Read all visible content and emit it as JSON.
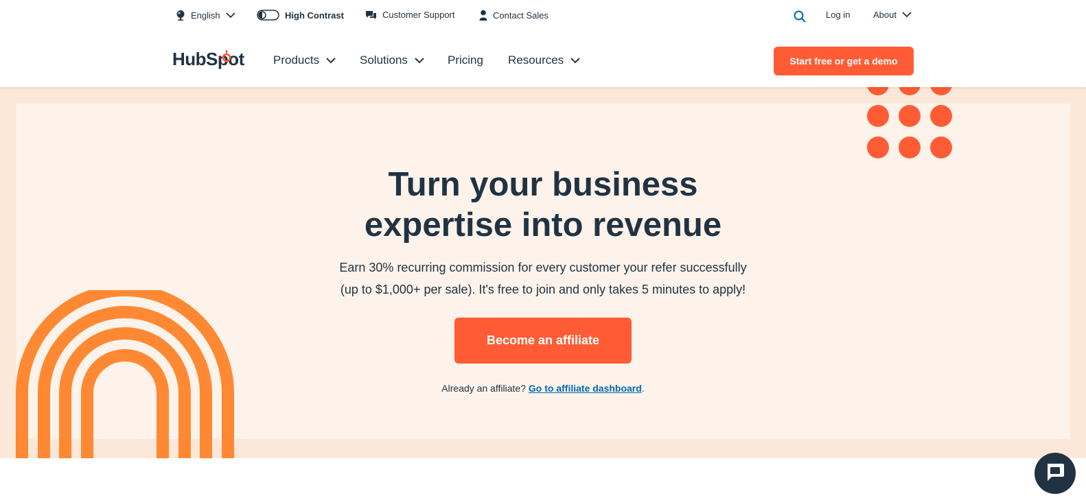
{
  "utility_bar": {
    "language": "English",
    "high_contrast": "High Contrast",
    "customer_support": "Customer Support",
    "contact_sales": "Contact Sales",
    "login": "Log in",
    "about": "About"
  },
  "navbar": {
    "logo": "HubSpot",
    "items": [
      {
        "label": "Products",
        "has_dropdown": true
      },
      {
        "label": "Solutions",
        "has_dropdown": true
      },
      {
        "label": "Pricing",
        "has_dropdown": false
      },
      {
        "label": "Resources",
        "has_dropdown": true
      }
    ],
    "cta": "Start free or get a demo"
  },
  "hero": {
    "headline_line1": "Turn your business",
    "headline_line2": "expertise into revenue",
    "sub_line1": "Earn 30% recurring commission for every customer your refer successfully",
    "sub_line2": "(up to $1,000+ per sale). It's free to join and only takes 5 minutes to apply!",
    "cta": "Become an affiliate",
    "already_text": "Already an affiliate?",
    "dashboard_link": "Go to affiliate dashboard",
    "period": "."
  },
  "colors": {
    "brand_orange": "#ff5c35",
    "navy": "#213343",
    "link_blue": "#0068b1",
    "arch_orange": "#ff8933",
    "hero_bg": "#fdf3ea",
    "hero_border": "#fce8d8"
  },
  "icons": {
    "language": "globe-icon",
    "contrast": "toggle-icon",
    "support": "chat-bubbles-icon",
    "sales": "person-icon",
    "search": "search-icon",
    "chat_widget": "chat-icon"
  }
}
